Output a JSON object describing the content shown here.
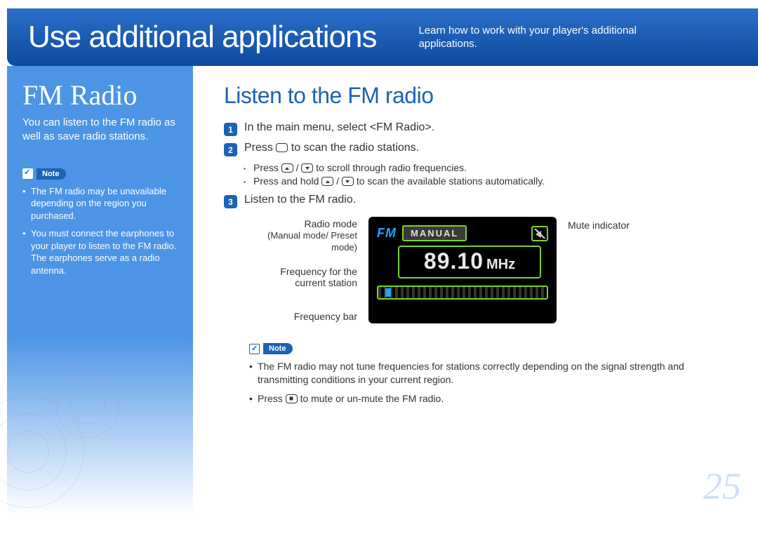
{
  "header": {
    "title": "Use additional applications",
    "subtitle": "Learn how to work with your player's additional applications."
  },
  "sidebar": {
    "title": "FM Radio",
    "intro": "You can listen to the FM radio as well as save radio stations.",
    "note_label": "Note",
    "notes": [
      "The FM radio may be unavailable depending on the region you purchased.",
      "You must connect the earphones to your player to listen to the FM radio. The earphones serve as a radio antenna."
    ]
  },
  "main": {
    "heading": "Listen to the FM radio",
    "steps": [
      {
        "num": "1",
        "text_before": "In the main menu, select <FM Radio>."
      },
      {
        "num": "2",
        "text_before": "Press ",
        "text_after": " to scan the radio stations."
      },
      {
        "num": "3",
        "text_before": "Listen to the FM radio."
      }
    ],
    "sub_bullets": {
      "b1_before": "Press ",
      "b1_after": " to scroll through radio frequencies.",
      "b2_before": "Press and hold ",
      "b2_after": " to scan the available stations automatically."
    },
    "diagram": {
      "radio_mode_label": "Radio mode",
      "radio_mode_sub": "(Manual mode/\nPreset mode)",
      "freq_label": "Frequency for the current station",
      "freq_bar_label": "Frequency bar",
      "mute_label": "Mute indicator",
      "fm_text": "FM",
      "mode_text": "MANUAL",
      "freq_value": "89.10",
      "freq_unit": "MHz"
    },
    "note_label": "Note",
    "main_notes_1": "The FM radio may not tune frequencies for stations correctly depending on the signal strength and transmitting conditions in your current region.",
    "main_notes_2_before": "Press ",
    "main_notes_2_after": " to mute or un-mute the FM radio."
  },
  "page_number": "25"
}
